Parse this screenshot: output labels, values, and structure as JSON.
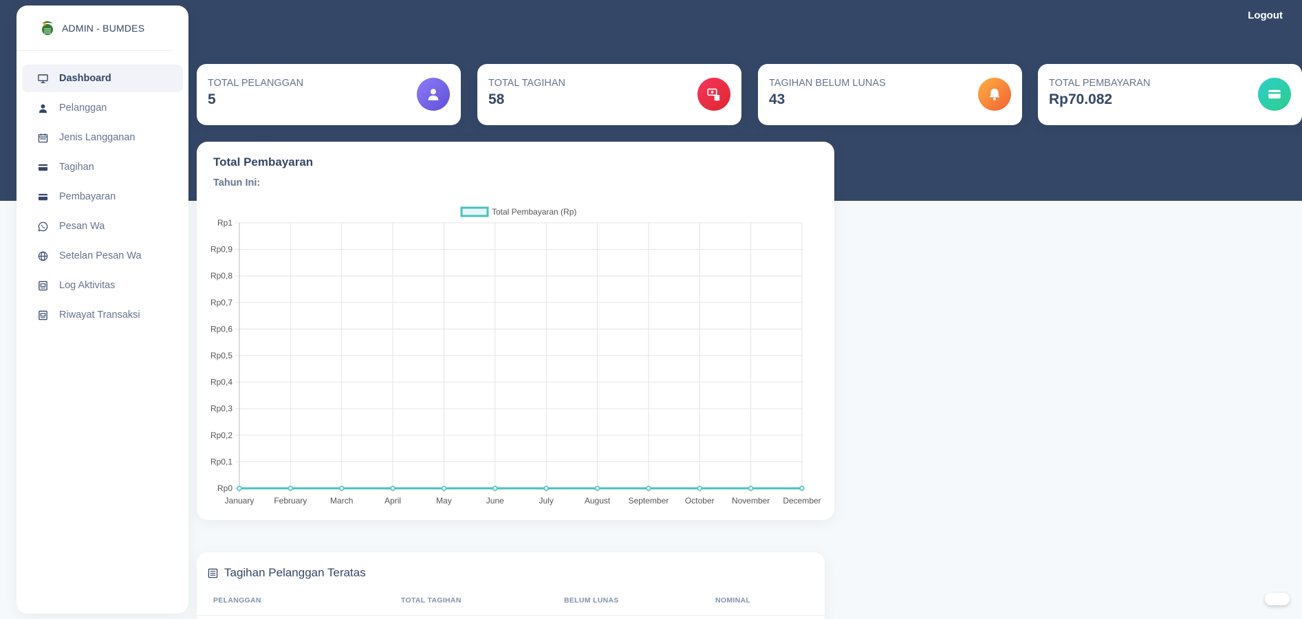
{
  "app": {
    "brand": "ADMIN - BUMDES",
    "logout_label": "Logout"
  },
  "sidebar": {
    "items": [
      {
        "label": "Dashboard",
        "icon": "monitor-icon",
        "active": true
      },
      {
        "label": "Pelanggan",
        "icon": "user-icon"
      },
      {
        "label": "Jenis Langganan",
        "icon": "calendar-icon"
      },
      {
        "label": "Tagihan",
        "icon": "credit-card-icon"
      },
      {
        "label": "Pembayaran",
        "icon": "credit-card-icon"
      },
      {
        "label": "Pesan Wa",
        "icon": "whatsapp-icon"
      },
      {
        "label": "Setelan Pesan Wa",
        "icon": "globe-icon"
      },
      {
        "label": "Log Aktivitas",
        "icon": "document-icon"
      },
      {
        "label": "Riwayat Transaksi",
        "icon": "document-icon"
      }
    ]
  },
  "stats": [
    {
      "title": "TOTAL PELANGGAN",
      "value": "5",
      "icon": "user-icon",
      "color": "#7367f0"
    },
    {
      "title": "TOTAL TAGIHAN",
      "value": "58",
      "icon": "money-stack-icon",
      "color": "#f5365c"
    },
    {
      "title": "TAGIHAN BELUM LUNAS",
      "value": "43",
      "icon": "bell-icon",
      "color": "#fb6340"
    },
    {
      "title": "TOTAL PEMBAYARAN",
      "value": "Rp70.082",
      "icon": "credit-card-icon",
      "color": "#2dce89"
    }
  ],
  "chart_card": {
    "title": "Total Pembayaran",
    "subtitle": "Tahun Ini:"
  },
  "chart_data": {
    "type": "line",
    "categories": [
      "January",
      "February",
      "March",
      "April",
      "May",
      "June",
      "July",
      "August",
      "September",
      "October",
      "November",
      "December"
    ],
    "series": [
      {
        "name": "Total Pembayaran (Rp)",
        "values": [
          0,
          0,
          0,
          0,
          0,
          0,
          0,
          0,
          0,
          0,
          0,
          0
        ],
        "color": "#4bc0c0"
      }
    ],
    "ylim": [
      0,
      1
    ],
    "yticks": [
      "Rp0",
      "Rp0,1",
      "Rp0,2",
      "Rp0,3",
      "Rp0,4",
      "Rp0,5",
      "Rp0,6",
      "Rp0,7",
      "Rp0,8",
      "Rp0,9",
      "Rp1"
    ],
    "grid": true,
    "legend": "top"
  },
  "table_card": {
    "title": "Tagihan Pelanggan Teratas",
    "columns": [
      "PELANGGAN",
      "TOTAL TAGIHAN",
      "BELUM LUNAS",
      "NOMINAL"
    ]
  }
}
